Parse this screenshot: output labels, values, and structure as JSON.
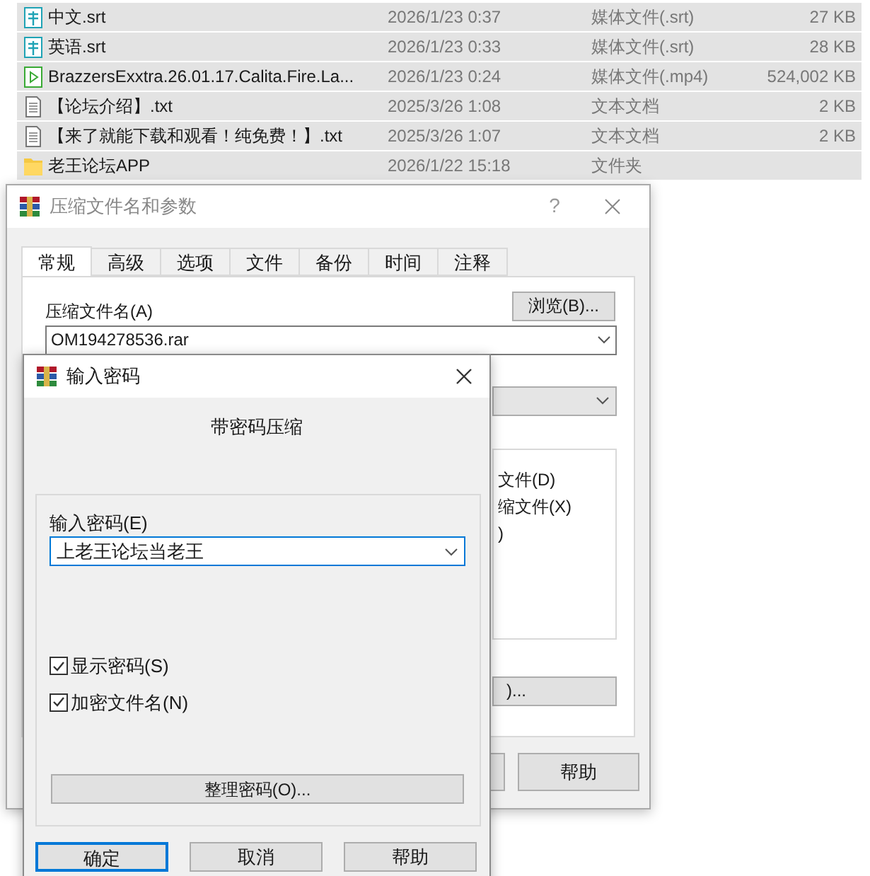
{
  "files": [
    {
      "kind": "subtitle",
      "name": "中文.srt",
      "date": "2026/1/23 0:37",
      "type": "媒体文件(.srt)",
      "size": "27 KB",
      "selected": true
    },
    {
      "kind": "subtitle",
      "name": "英语.srt",
      "date": "2026/1/23 0:33",
      "type": "媒体文件(.srt)",
      "size": "28 KB",
      "selected": true
    },
    {
      "kind": "video",
      "name": "BrazzersExxtra.26.01.17.Calita.Fire.La...",
      "date": "2026/1/23 0:24",
      "type": "媒体文件(.mp4)",
      "size": "524,002 KB",
      "selected": true
    },
    {
      "kind": "text",
      "name": "【论坛介绍】.txt",
      "date": "2025/3/26 1:08",
      "type": "文本文档",
      "size": "2 KB",
      "selected": true
    },
    {
      "kind": "text",
      "name": "【来了就能下载和观看！纯免费！】.txt",
      "date": "2025/3/26 1:07",
      "type": "文本文档",
      "size": "2 KB",
      "selected": true
    },
    {
      "kind": "folder",
      "name": "老王论坛APP",
      "date": "2026/1/22 15:18",
      "type": "文件夹",
      "selected": true
    }
  ],
  "archive_dialog": {
    "title": "压缩文件名和参数",
    "help_button": "?",
    "tabs": [
      {
        "label": "常规",
        "selected": true
      },
      {
        "label": "高级",
        "selected": false
      },
      {
        "label": "选项",
        "selected": false
      },
      {
        "label": "文件",
        "selected": false
      },
      {
        "label": "备份",
        "selected": false
      },
      {
        "label": "时间",
        "selected": false
      },
      {
        "label": "注释",
        "selected": false
      }
    ],
    "archive_name_label": "压缩文件名(A)",
    "browse_button": "浏览(B)...",
    "archive_name": "OM194278536.rar",
    "options_fragments": [
      "文件(D)",
      "缩文件(X)",
      ")"
    ],
    "button_fragment": ")...",
    "help": "帮助"
  },
  "password_dialog": {
    "title": "输入密码",
    "heading": "带密码压缩",
    "password_label": "输入密码(E)",
    "password": "上老王论坛当老王",
    "checkboxes": [
      {
        "label": "显示密码(S)",
        "checked": true
      },
      {
        "label": "加密文件名(N)",
        "checked": true
      }
    ],
    "organize_button": "整理密码(O)...",
    "buttons": [
      {
        "label": "确定",
        "default": true
      },
      {
        "label": "取消",
        "default": false
      },
      {
        "label": "帮助",
        "default": false
      }
    ]
  }
}
